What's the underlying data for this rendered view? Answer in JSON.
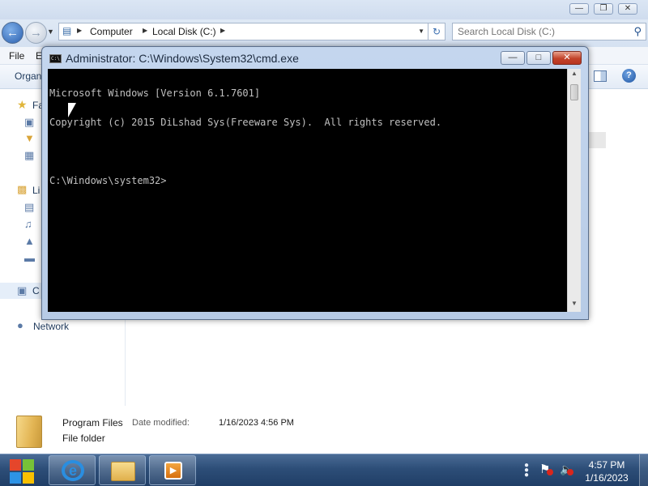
{
  "explorer": {
    "breadcrumb": [
      "Computer",
      "Local Disk (C:)"
    ],
    "search_placeholder": "Search Local Disk (C:)",
    "menu": {
      "file": "File",
      "edit_partial": "E"
    },
    "command_bar": {
      "organize_partial": "Organ"
    },
    "nav_pane": {
      "favorites_partial": "Fa",
      "libraries_partial": "Li",
      "computer_partial": "C",
      "network": "Network"
    },
    "details": {
      "name": "Program Files",
      "modified_label": "Date modified:",
      "modified_value": "1/16/2023 4:56 PM",
      "type": "File folder"
    }
  },
  "cmd": {
    "title": "Administrator: C:\\Windows\\System32\\cmd.exe",
    "lines": [
      "Microsoft Windows [Version 6.1.7601]",
      "Copyright (c) 2015 DiLshad Sys(Freeware Sys).  All rights reserved.",
      "",
      "C:\\Windows\\system32>"
    ]
  },
  "taskbar": {
    "clock_time": "4:57 PM",
    "clock_date": "1/16/2023",
    "pinned": [
      "internet-explorer-icon",
      "windows-explorer-icon",
      "media-player-icon"
    ]
  },
  "icons": {
    "back": "back-arrow-icon",
    "forward": "forward-arrow-icon",
    "search": "search-icon",
    "help": "help-icon",
    "flag": "action-center-flag-icon",
    "volume": "volume-muted-icon"
  },
  "colors": {
    "console_bg": "#000000",
    "console_text": "#c0c0c0",
    "close_button": "#c2432a",
    "taskbar": "#2d4e78"
  }
}
